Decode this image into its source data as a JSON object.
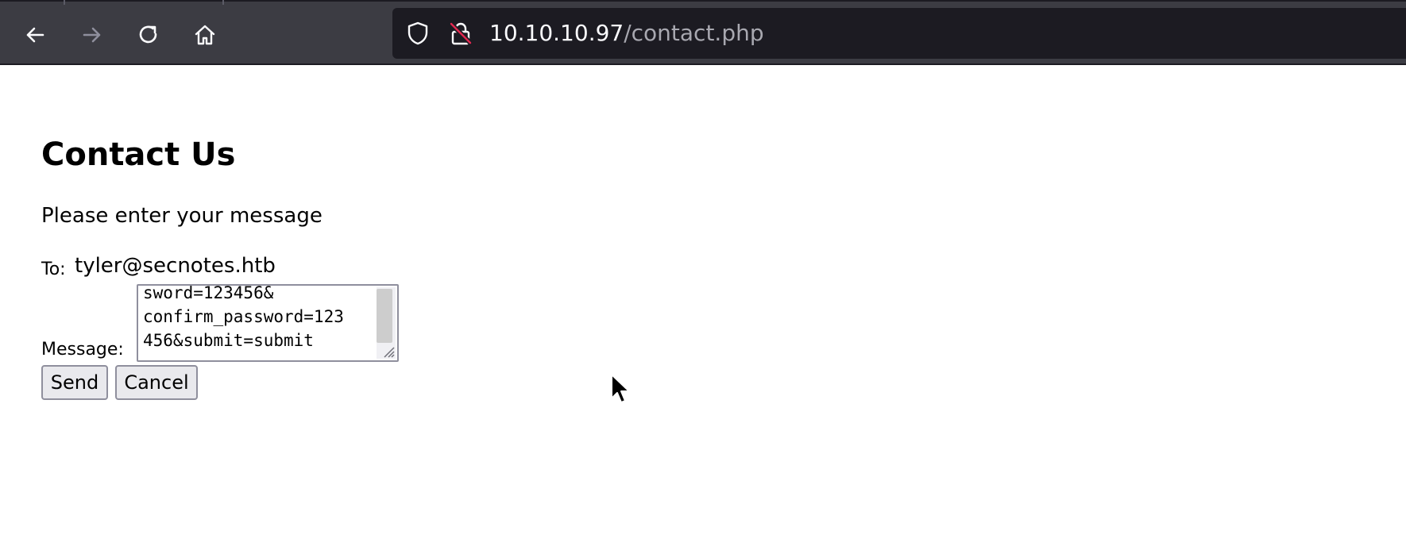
{
  "browser": {
    "url_host": "10.10.10.97",
    "url_path": "/contact.php",
    "back_icon": "back-arrow-icon",
    "forward_icon": "forward-arrow-icon",
    "reload_icon": "reload-icon",
    "home_icon": "home-icon",
    "tracking_icon": "shield-icon",
    "security_icon": "insecure-lock-icon",
    "colors": {
      "toolbar_bg": "#3c3c43",
      "urlbar_bg": "#1c1b22",
      "host_text": "#fbfbfe",
      "path_text": "#a8a8b0",
      "insecure_slash": "#e22850"
    }
  },
  "page": {
    "title": "Contact Us",
    "intro": "Please enter your message",
    "to_label": "To:",
    "to_value": "tyler@secnotes.htb",
    "message_label": "Message:",
    "message_value": "sword=123456&\nconfirm_password=123\n456&submit=submit",
    "send_label": "Send",
    "cancel_label": "Cancel"
  }
}
